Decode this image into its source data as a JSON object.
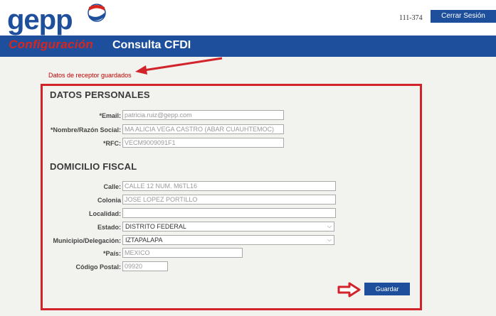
{
  "header": {
    "logo_text": "gepp",
    "user_code": "111-374",
    "logout_label": "Cerrar Sesión"
  },
  "nav": {
    "section": "Configuración",
    "page": "Consulta CFDI"
  },
  "status_message": "Datos de receptor guardados",
  "personal": {
    "title": "DATOS PERSONALES",
    "email_label": "*Email:",
    "email_value": "patricia.ruiz@gepp.com",
    "name_label": "*Nombre/Razón Social:",
    "name_value": "MA ALICIA VEGA CASTRO (ABAR CUAUHTEMOC)",
    "rfc_label": "*RFC:",
    "rfc_value": "VECM9009091F1"
  },
  "address": {
    "title": "DOMICILIO FISCAL",
    "street_label": "Calle:",
    "street_value": "CALLE 12 NUM. M6TL16",
    "colonia_label": "Colonia",
    "colonia_value": "JOSE LOPEZ PORTILLO",
    "localidad_label": "Localidad:",
    "localidad_value": "",
    "estado_label": "Estado:",
    "estado_value": "DISTRITO FEDERAL",
    "municipio_label": "Municipio/Delegación:",
    "municipio_value": "IZTAPALAPA",
    "pais_label": "*País:",
    "pais_value": "MEXICO",
    "cp_label": "Código Postal:",
    "cp_value": "09920"
  },
  "save_label": "Guardar",
  "colors": {
    "brand_blue": "#1d4f9c",
    "alert_red": "#d3232a"
  },
  "icons": [
    "pepsi-globe-icon",
    "chevron-down-icon",
    "arrow-right-icon"
  ]
}
